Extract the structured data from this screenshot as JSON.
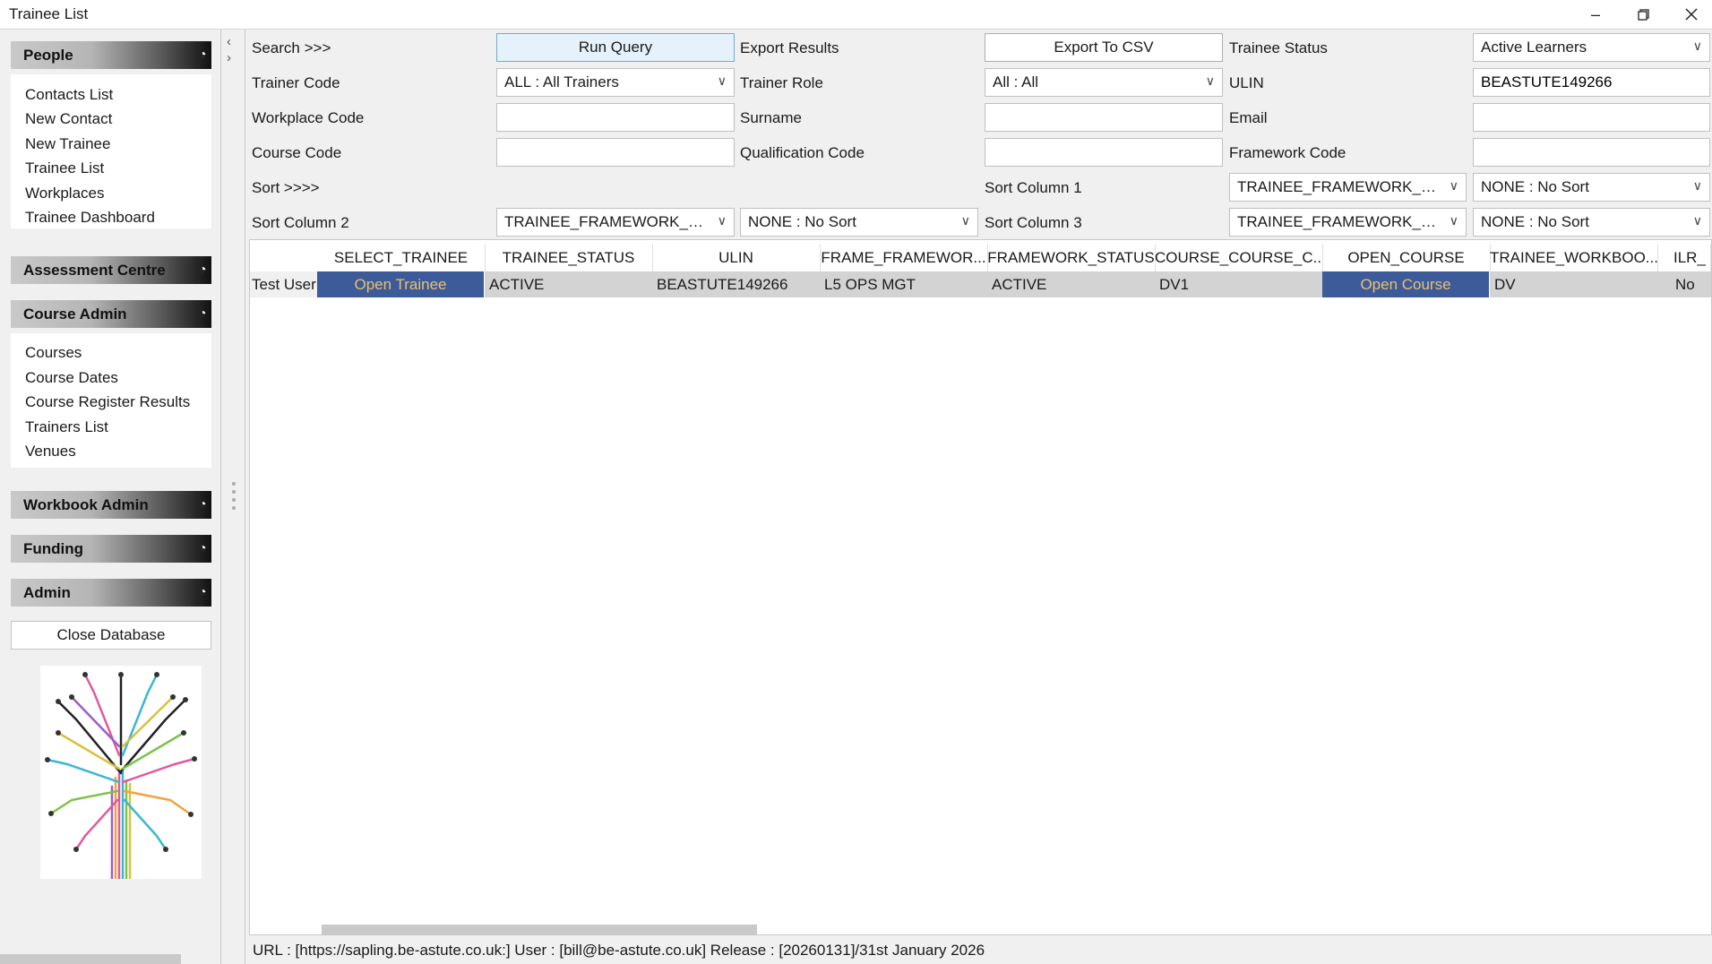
{
  "window": {
    "title": "Trainee List"
  },
  "sidebar": {
    "sections": [
      {
        "label": "People",
        "items": [
          "Contacts List",
          "New Contact",
          "New Trainee",
          "Trainee List",
          "Workplaces",
          "Trainee Dashboard"
        ]
      },
      {
        "label": "Assessment Centre",
        "items": []
      },
      {
        "label": "Course Admin",
        "items": [
          "Courses",
          "Course Dates",
          "Course Register Results",
          "Trainers List",
          "Venues"
        ]
      },
      {
        "label": "Workbook Admin",
        "items": []
      },
      {
        "label": "Funding",
        "items": []
      },
      {
        "label": "Admin",
        "items": []
      }
    ],
    "close_db_label": "Close Database"
  },
  "form": {
    "search_label": "Search >>>",
    "run_query_label": "Run Query",
    "export_results_label": "Export Results",
    "export_csv_label": "Export To CSV",
    "trainee_status_label": "Trainee Status",
    "trainee_status_value": "Active Learners",
    "trainer_code_label": "Trainer Code",
    "trainer_code_value": "ALL : All Trainers",
    "trainer_role_label": "Trainer Role",
    "trainer_role_value": "All : All",
    "ulin_label": "ULIN",
    "ulin_value": "BEASTUTE149266",
    "workplace_code_label": "Workplace Code",
    "workplace_code_value": "",
    "surname_label": "Surname",
    "surname_value": "",
    "email_label": "Email",
    "email_value": "",
    "course_code_label": "Course Code",
    "course_code_value": "",
    "qualification_code_label": "Qualification Code",
    "qualification_code_value": "",
    "framework_code_label": "Framework Code",
    "framework_code_value": "",
    "sort_label": "Sort >>>>",
    "sort_col1_label": "Sort Column 1",
    "sort_col1_field": "TRAINEE_FRAMEWORK_R...",
    "sort_col1_order": "NONE : No Sort",
    "sort_col2_label": "Sort Column 2",
    "sort_col2_field": "TRAINEE_FRAMEWORK_R...",
    "sort_col2_order": "NONE : No Sort",
    "sort_col3_label": "Sort Column 3",
    "sort_col3_field": "TRAINEE_FRAMEWORK_R...",
    "sort_col3_order": "NONE : No Sort"
  },
  "grid": {
    "columns": [
      "SELECT_TRAINEE",
      "TRAINEE_STATUS",
      "ULIN",
      "FRAME_FRAMEWOR...",
      "FRAMEWORK_STATUS",
      "COURSE_COURSE_C...",
      "OPEN_COURSE",
      "TRAINEE_WORKBOO...",
      "ILR_"
    ],
    "rows": [
      {
        "row_header": "Test User",
        "select_trainee": "Open Trainee",
        "trainee_status": "ACTIVE",
        "ulin": "BEASTUTE149266",
        "frame_framework": "L5 OPS MGT",
        "framework_status": "ACTIVE",
        "course_code": "DV1",
        "open_course": "Open Course",
        "trainee_workbook": "DV",
        "ilr": "No"
      }
    ]
  },
  "status_bar": {
    "text": "URL :  [https://sapling.be-astute.co.uk:] User : [bill@be-astute.co.uk] Release : [20260131]/31st January 2026"
  },
  "icons": {
    "minimize": "minimize-icon",
    "maximize": "restore-icon",
    "close": "close-icon",
    "collapse": "chevron-up-icon",
    "dropdown": "chevron-down-icon"
  }
}
